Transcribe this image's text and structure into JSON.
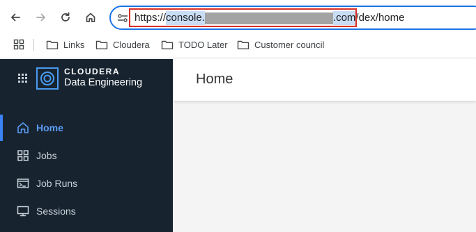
{
  "browser": {
    "url": {
      "prefix": "https://",
      "selected_start": "console.",
      "selected_end": ".com",
      "suffix": "/dex/home"
    },
    "bookmarks": [
      {
        "label": "Links",
        "icon": "folder-icon"
      },
      {
        "label": "Cloudera",
        "icon": "folder-icon"
      },
      {
        "label": "TODO Later",
        "icon": "folder-icon"
      },
      {
        "label": "Customer council",
        "icon": "folder-icon"
      }
    ]
  },
  "app": {
    "brand_line1": "CLOUDERA",
    "brand_line2": "Data Engineering",
    "menu": [
      {
        "label": "Home",
        "icon": "home-icon",
        "active": true
      },
      {
        "label": "Jobs",
        "icon": "grid-icon",
        "active": false
      },
      {
        "label": "Job Runs",
        "icon": "terminal-icon",
        "active": false
      },
      {
        "label": "Sessions",
        "icon": "monitor-icon",
        "active": false
      }
    ],
    "page_title": "Home"
  },
  "colors": {
    "sidebar_bg": "#172430",
    "accent": "#3b82f6",
    "omnibox_border": "#1a73e8",
    "highlight_box": "#d93025",
    "content_bg": "#f4f4f4"
  }
}
